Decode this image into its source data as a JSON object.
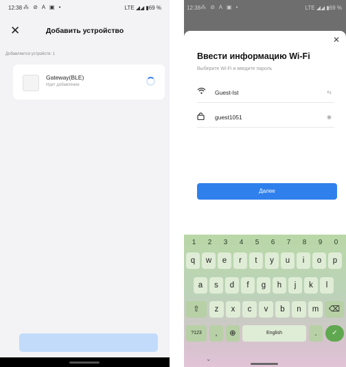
{
  "left": {
    "status": {
      "time": "12:38",
      "icons": "⁂ ⊘ A ▣ •",
      "network": "LTE ◢◢ ▮69 %"
    },
    "title": "Добавить устройство",
    "adding_label": "Добавляется устройств: 1",
    "device": {
      "name": "Gateway(BLE)",
      "status": "Идет добавление"
    }
  },
  "right": {
    "status": {
      "time": "12:38",
      "icons": "⁂ ⊘ A ▣ •",
      "network": "LTE ◢◢ ▮69 %"
    },
    "title": "Ввести информацию Wi-Fi",
    "subtitle": "Выберите Wi-Fi и введите пароль",
    "ssid": "Guest-Ist",
    "password": "guest1051",
    "next_label": "Далее",
    "keyboard": {
      "digits": [
        "1",
        "2",
        "3",
        "4",
        "5",
        "6",
        "7",
        "8",
        "9",
        "0"
      ],
      "row1": [
        "q",
        "w",
        "e",
        "r",
        "t",
        "y",
        "u",
        "i",
        "o",
        "p"
      ],
      "row2": [
        "a",
        "s",
        "d",
        "f",
        "g",
        "h",
        "j",
        "k",
        "l"
      ],
      "row3": [
        "z",
        "x",
        "c",
        "v",
        "b",
        "n",
        "m"
      ],
      "symbols_key": "?123",
      "comma_key": ",",
      "space_label": "English",
      "period_key": "."
    }
  }
}
